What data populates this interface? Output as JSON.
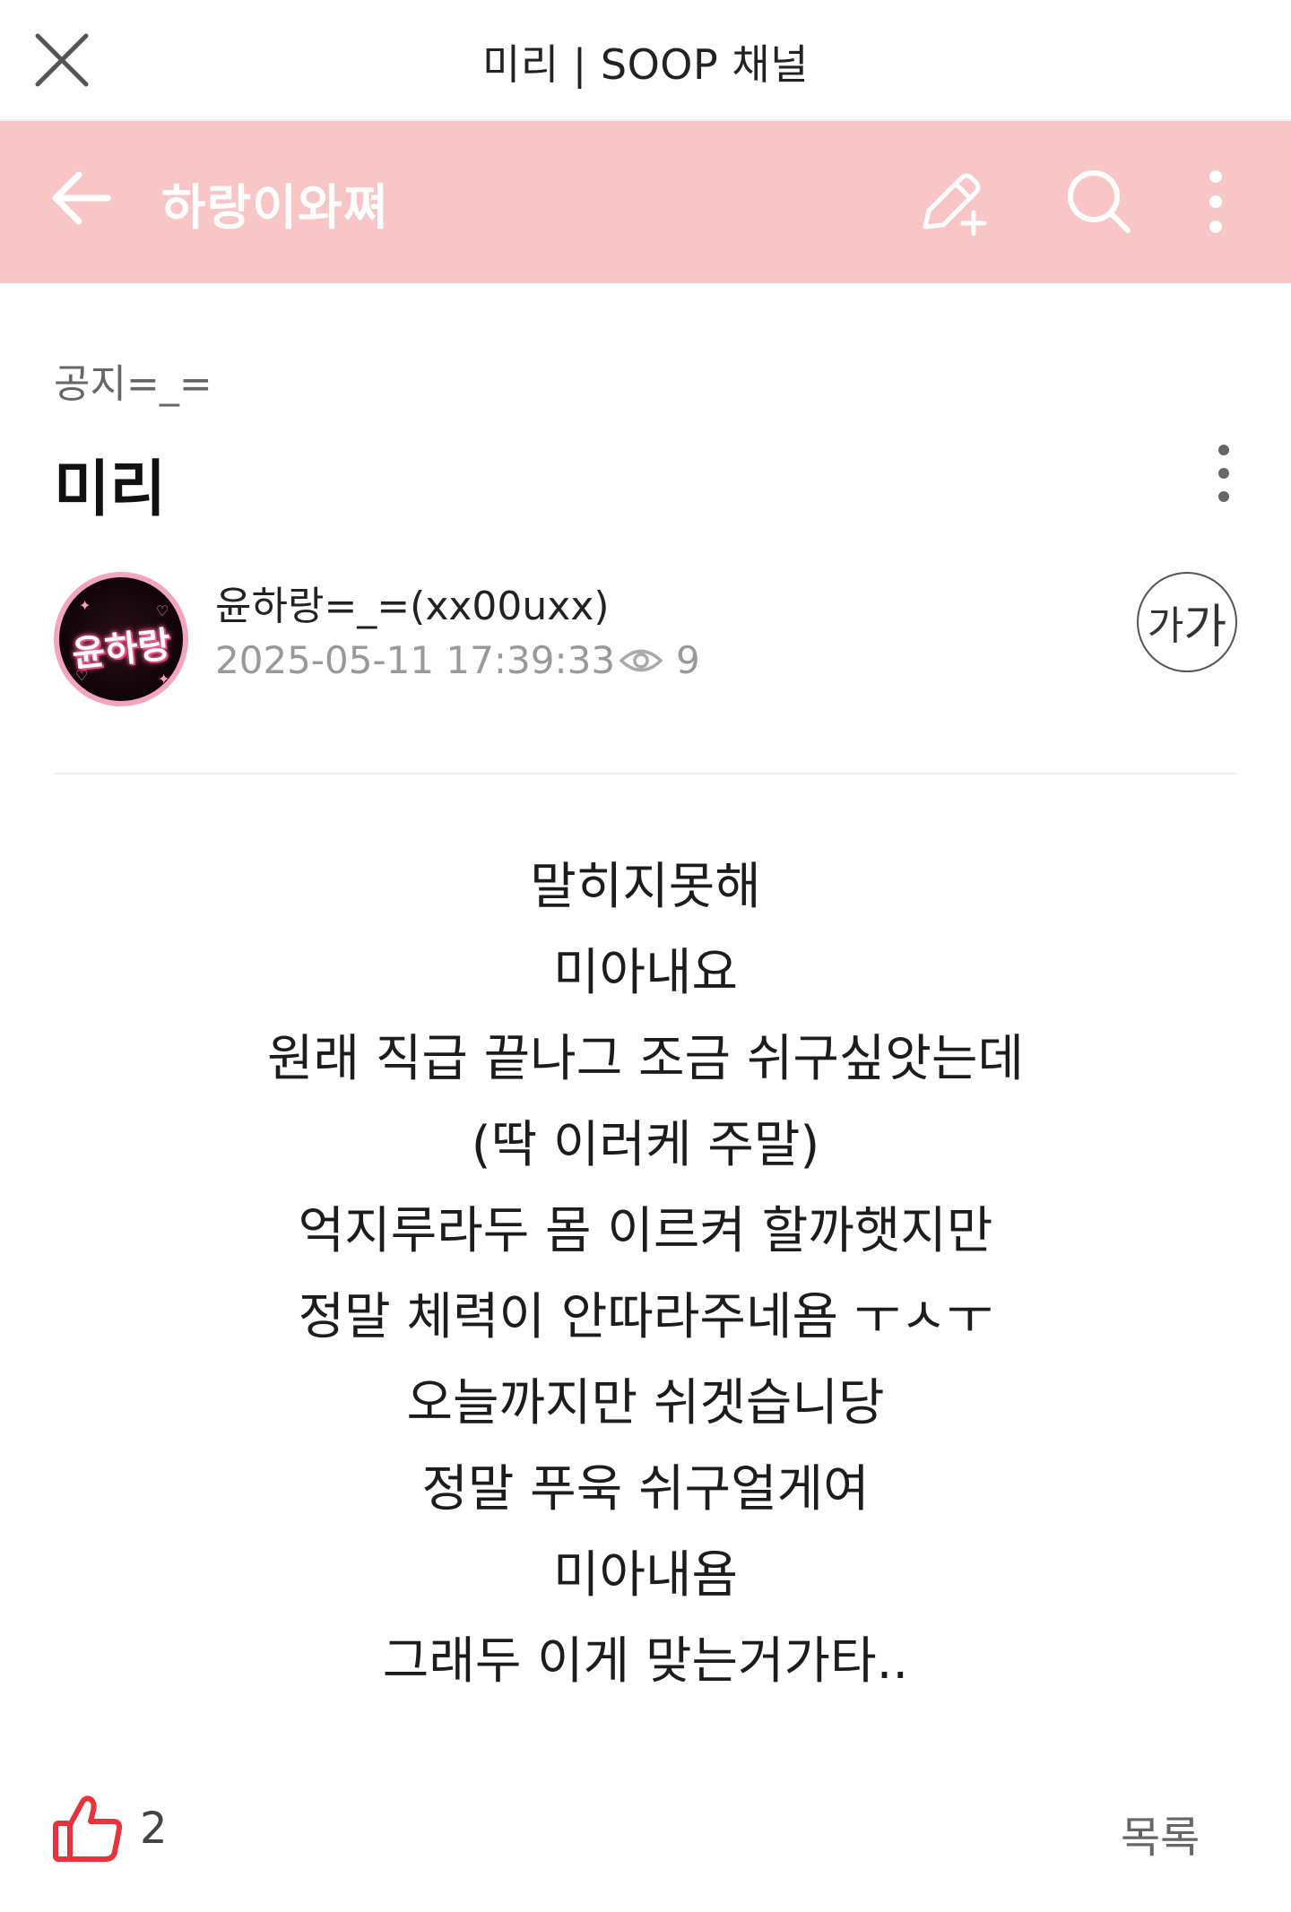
{
  "window": {
    "title": "미리 | SOOP 채널"
  },
  "header": {
    "channel_name": "하랑이와쪄",
    "background_color": "#f9c6c8"
  },
  "post": {
    "category": "공지=_=",
    "title": "미리",
    "author": {
      "name": "윤하랑=_=(xx00uxx)",
      "avatar_text": "윤하랑"
    },
    "date": "2025-05-11 17:39:33",
    "views": "9",
    "font_size_button": {
      "small": "가",
      "large": "가"
    },
    "body_lines": [
      "말히지못해",
      "미아내요",
      "원래 직급 끝나그 조금 쉬구싶앗는데",
      "(딱 이러케 주말)",
      "억지루라두 몸 이르켜 할까햇지만",
      "정말 체력이 안따라주네욤 ㅜㅅㅜ",
      "오늘까지만 쉬겟습니당",
      "정말 푸욱 쉬구얼게여",
      "미아내욤",
      "그래두 이게 맞는거가타.."
    ],
    "likes": "2",
    "list_label": "목록"
  },
  "icons": {
    "close": "close-icon",
    "back": "arrow-left-icon",
    "write": "pencil-plus-icon",
    "search": "search-icon",
    "more": "more-vertical-icon",
    "views": "eye-icon",
    "like": "thumbs-up-icon"
  },
  "colors": {
    "like_accent": "#e8323c",
    "header_text": "#ffffff"
  }
}
